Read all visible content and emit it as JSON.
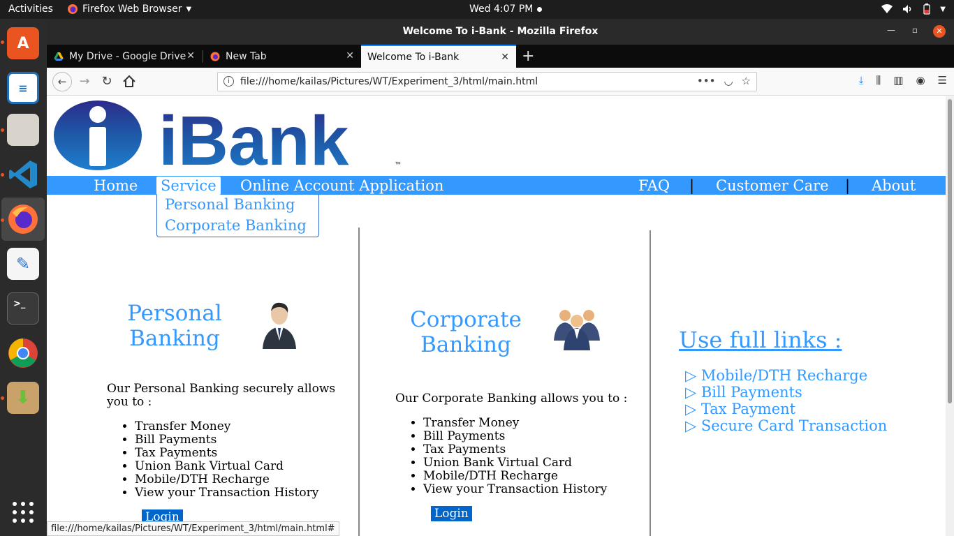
{
  "system_bar": {
    "activities": "Activities",
    "app_name": "Firefox Web Browser",
    "clock": "Wed  4:07 PM"
  },
  "window": {
    "title": "Welcome To i-Bank - Mozilla Firefox"
  },
  "tabs": [
    {
      "label": "My Drive - Google Drive",
      "icon": "google-drive-icon"
    },
    {
      "label": "New Tab",
      "icon": "firefox-icon"
    },
    {
      "label": "Welcome To i-Bank",
      "icon": "none",
      "selected": true
    }
  ],
  "navbar": {
    "url": "file:///home/kailas/Pictures/WT/Experiment_3/html/main.html"
  },
  "page": {
    "logo_text": "iBank",
    "logo_tm": "™",
    "menu": {
      "home": "Home",
      "service": "Service",
      "online_account": "Online Account Application",
      "faq": "FAQ",
      "separator": "|",
      "customer_care": "Customer Care",
      "about": "About"
    },
    "dropdown": {
      "personal": "Personal Banking",
      "corporate": "Corporate Banking"
    },
    "personal": {
      "title_line1": "Personal",
      "title_line2": "Banking",
      "intro": "Our Personal Banking securely allows you to :",
      "items": [
        "Transfer Money",
        "Bill Payments",
        "Tax Payments",
        "Union Bank Virtual Card",
        "Mobile/DTH Recharge",
        "View your Transaction History"
      ],
      "login": "Login"
    },
    "corporate": {
      "title_line1": "Corporate",
      "title_line2": "Banking",
      "intro": "Our Corporate Banking allows you to :",
      "items": [
        "Transfer Money",
        "Bill Payments",
        "Tax Payments",
        "Union Bank Virtual Card",
        "Mobile/DTH Recharge",
        "View your Transaction History"
      ],
      "login": "Login"
    },
    "useful_links": {
      "title": "Use full links :",
      "items": [
        "▷ Mobile/DTH Recharge",
        "▷ Bill Payments",
        "▷ Tax Payment",
        "▷ Secure Card Transaction"
      ]
    }
  },
  "statusbar": {
    "text": "file:///home/kailas/Pictures/WT/Experiment_3/html/main.html#"
  },
  "colors": {
    "menu_blue": "#3399ff",
    "login_blue": "#0066cc",
    "ubuntu_orange": "#e95420"
  }
}
